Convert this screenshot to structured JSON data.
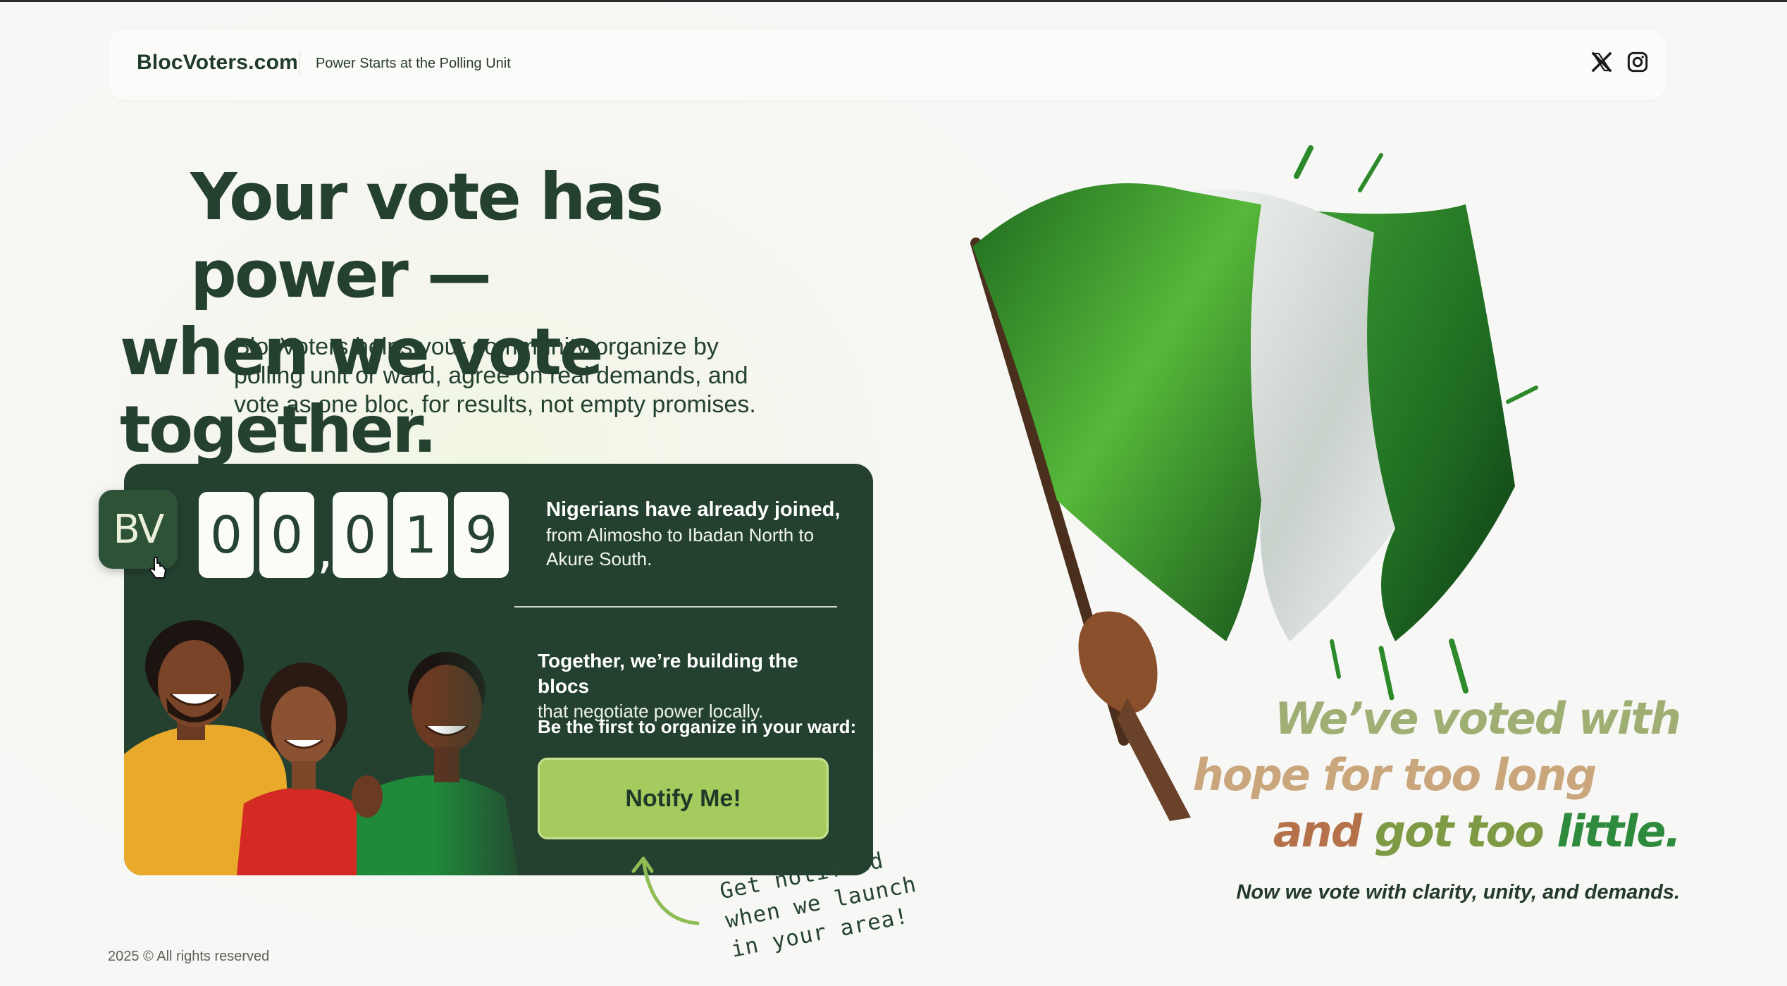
{
  "header": {
    "brand": "BlocVoters.com",
    "tagline": "Power Starts at the Polling Unit",
    "social": [
      "x-icon",
      "instagram-icon"
    ]
  },
  "hero": {
    "title_line1": "Your vote has power —",
    "title_line2": "when we vote together.",
    "subtitle": "BlocVoters helps your community organize by polling unit or ward, agree on real demands, and vote as one bloc, for results, not empty promises."
  },
  "card": {
    "logo_text": "BV",
    "counter": {
      "digits": [
        "0",
        "0",
        "0",
        "1",
        "9"
      ],
      "value": "00,019"
    },
    "joined_title": "Nigerians have already joined,",
    "joined_detail": "from Alimosho to Ibadan North to Akure South.",
    "together_title": "Together, we’re building the blocs",
    "together_detail": "that negotiate power locally.",
    "first_organize": "Be the first to organize in your ward:",
    "notify_button": "Notify Me!"
  },
  "handnote": "Get notified when we launch in your area!",
  "quote": {
    "line1": "We’ve voted with",
    "line2": "hope for too long",
    "line3a": "and",
    "line3b": "got too",
    "line3c": "little.",
    "sub": "Now we vote with clarity, unity, and demands."
  },
  "footer": "2025 © All rights reserved",
  "colors": {
    "dark_green": "#244130",
    "accent_green": "#a5cb5e",
    "text": "#24402f"
  }
}
